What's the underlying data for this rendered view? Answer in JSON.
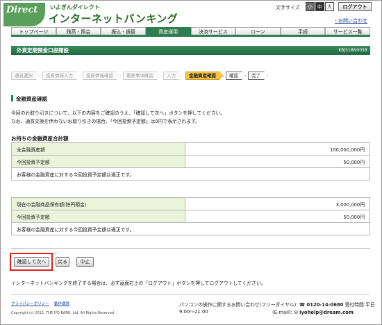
{
  "header": {
    "logo_text": "Direct",
    "logo_sub": "いよぎんダイレクト",
    "brand_sub": "いよぎんダイレクト",
    "brand_main": "インターネットバンキング",
    "font_size_label": "文字サイズ",
    "font_small": "小",
    "font_mid": "中",
    "font_big": "大",
    "logout": "ログアウト",
    "inquiry": "› お問い合わせ"
  },
  "nav": [
    "トップページ",
    "残高・照会",
    "振込・振替",
    "資産運用",
    "決済サービス",
    "ローン",
    "手続",
    "サービス一覧"
  ],
  "nav_active_index": 3,
  "page": {
    "title": "外貨定期預金口座開設",
    "id": "KBJ51BN005B"
  },
  "steps": [
    "通貨選択",
    "投資情報入力",
    "投資情報確認",
    "重要事項確認",
    "入力",
    "金融資産確認",
    "確認",
    "完了"
  ],
  "step_active_index": 5,
  "section": {
    "heading": "金融資産確認",
    "notice1": "今回のお取り引きについて、以下の内容をご確認のうえ、「確認して次へ」ボタンを押してください。",
    "notice2": "なお、通貨交換を伴わないお取り引きの場合、「今回投資予定額」は0円で表示されます。",
    "table_heading": "お持ちの金融資産合計額"
  },
  "table1": {
    "rows": [
      {
        "label": "全金融資産額",
        "value": "100,000,000円"
      },
      {
        "label": "今回投資予定額",
        "value": "50,000円"
      }
    ],
    "note": "お客様の金融資産に対する今回投資予定額は適正です。"
  },
  "table2": {
    "rows": [
      {
        "label": "現在の金融商品保有額(除円預金)",
        "value": "3,000,000円"
      },
      {
        "label": "今回投資予定額",
        "value": "50,000円"
      }
    ],
    "note": "お客様の金融資産に対する今回投資予定額は適正です。"
  },
  "buttons": {
    "confirm_next": "確認して次へ",
    "back": "戻る",
    "cancel": "中止"
  },
  "logout_note": "インターネットバンキングを終了する場合は、必ず画面右上の「ログアウト」ボタンを押してログアウトしてください。",
  "footer": {
    "privacy": "プライバシーポリシー",
    "terms": "動作環境",
    "copyright": "Copyright (c) 2012, THE IYO BANK, Ltd. All Rights Reserved.",
    "contact_label": "パソコンの操作に関するお問い合わせ(フリーダイヤル):",
    "phone": "☎ 0120-14-0680",
    "hours": "受付時間:平日9:00～21:00",
    "email_label": "(E-mail):",
    "email": "✉ iyohelp@dream.com"
  }
}
